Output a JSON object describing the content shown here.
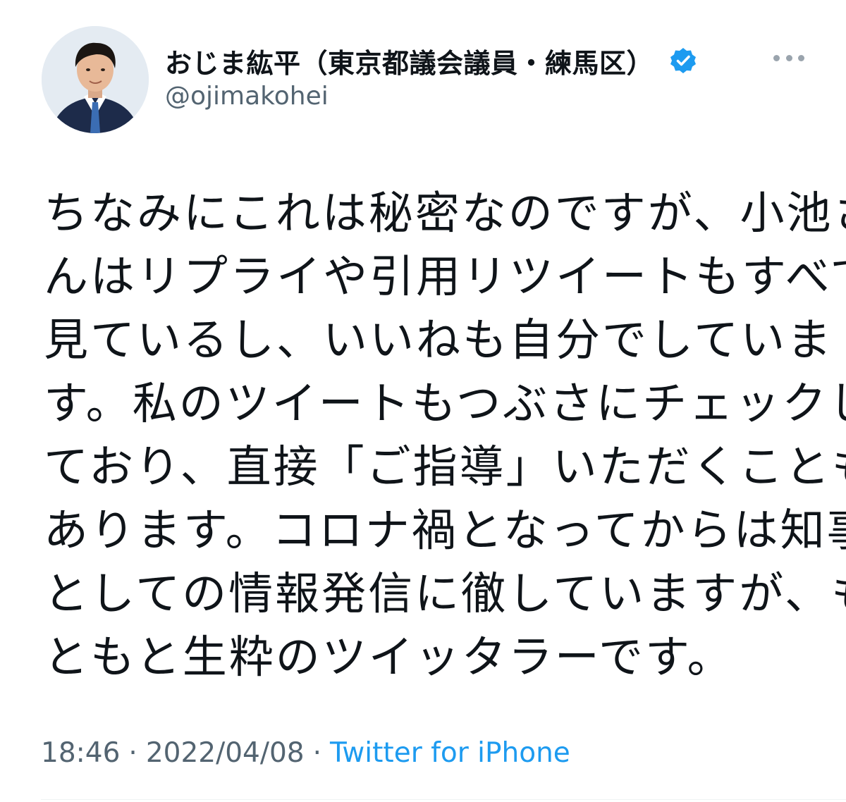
{
  "author": {
    "display_name": "おじま紘平（東京都議会議員・練馬区）",
    "handle": "@ojimakohei",
    "verified": true,
    "avatar_icon": "profile-photo-avatar"
  },
  "more_icon": "more-options-icon",
  "body_lines": [
    "ちなみにこれは秘密なのですが、小池さ",
    "んはリプライや引用リツイートもすべて",
    "見ているし、いいねも自分でしていま",
    "す。私のツイートもつぶさにチェックし",
    "ており、直接「ご指導」いただくことも",
    "あります。コロナ禍となってからは知事",
    "としての情報発信に徹していますが、も",
    "ともと生粋のツイッタラーです。"
  ],
  "meta": {
    "time": "18:46",
    "separator": "·",
    "date": "2022/04/08",
    "source": "Twitter for iPhone"
  },
  "colors": {
    "text": "#0f1419",
    "secondary": "#536471",
    "accent": "#1d9bf0",
    "verified_badge": "#1d9bf0"
  }
}
